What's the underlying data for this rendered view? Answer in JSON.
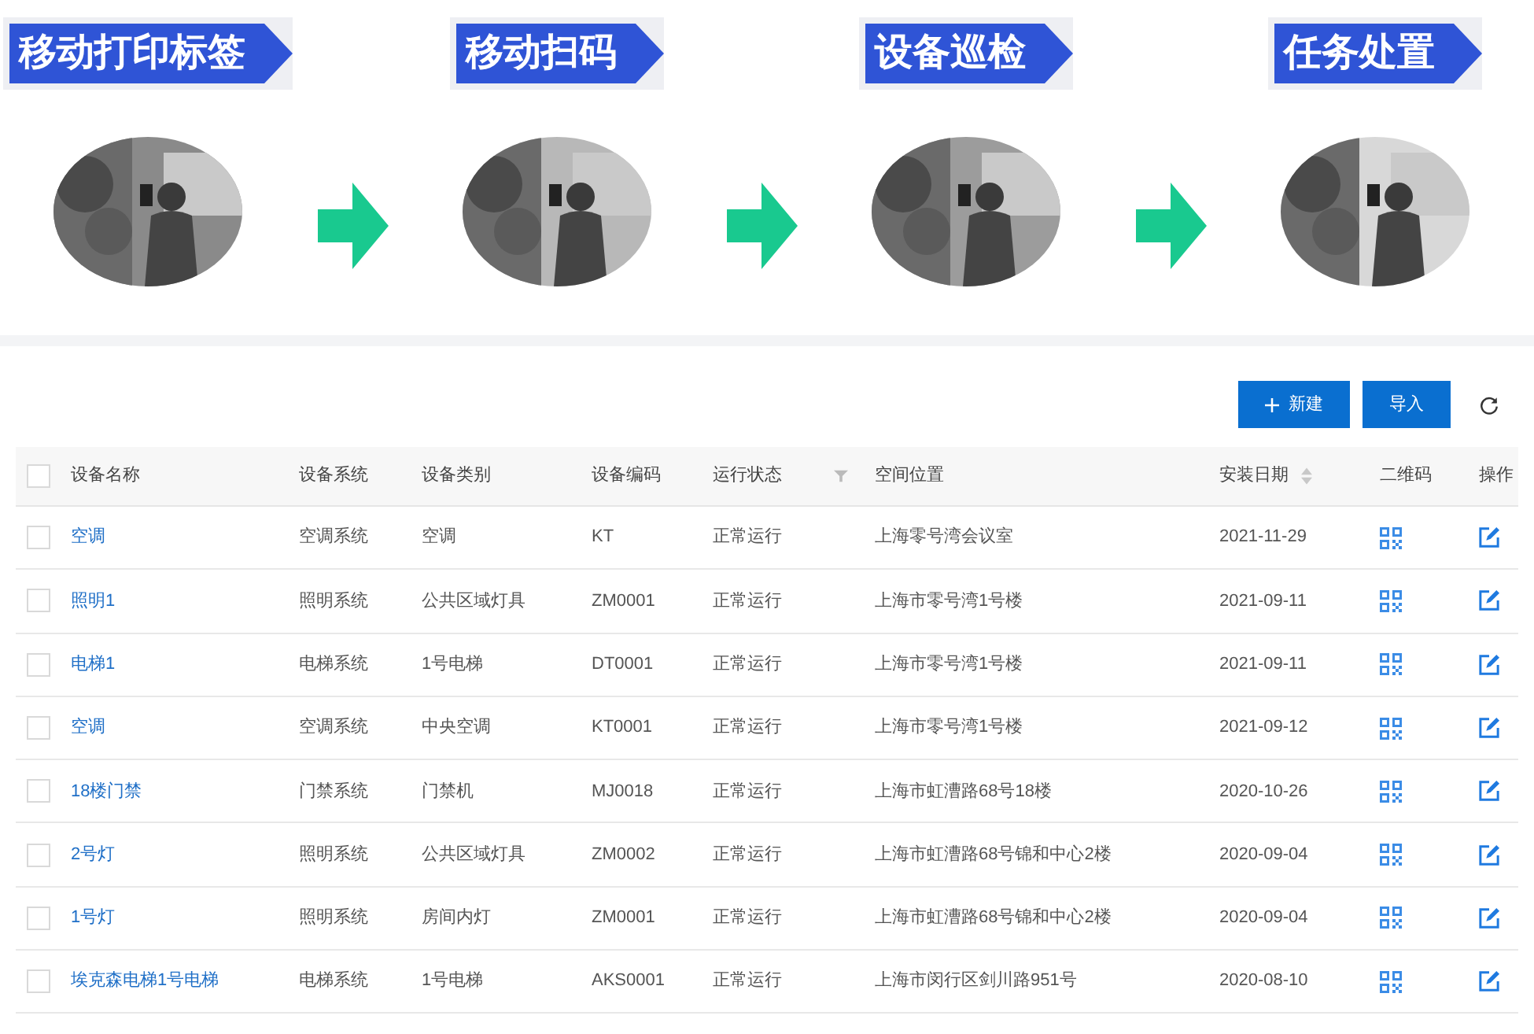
{
  "steps": [
    {
      "label": "移动打印标签",
      "kind": "picture"
    },
    {
      "label": "移动扫码",
      "kind": "picture"
    },
    {
      "label": "设备巡检",
      "kind": "picture"
    },
    {
      "label": "任务处置",
      "kind": "picture"
    }
  ],
  "toolbar": {
    "buttons": [
      {
        "label": "新建",
        "kind": "add"
      },
      {
        "label": "导入",
        "kind": "plain"
      }
    ]
  },
  "table": {
    "all_selected": false,
    "columns": [
      "设备名称",
      "设备系统",
      "设备类别",
      "设备编码",
      "运行状态",
      "空间位置",
      "安装日期",
      "二维码",
      "操作"
    ],
    "rows": [
      {
        "selected": false,
        "cells": [
          "空调",
          "空调系统",
          "空调",
          "KT",
          "正常运行",
          "上海零号湾会议室",
          "2021-11-29"
        ]
      },
      {
        "selected": false,
        "cells": [
          "照明1",
          "照明系统",
          "公共区域灯具",
          "ZM0001",
          "正常运行",
          "上海市零号湾1号楼",
          "2021-09-11"
        ]
      },
      {
        "selected": false,
        "cells": [
          "电梯1",
          "电梯系统",
          "1号电梯",
          "DT0001",
          "正常运行",
          "上海市零号湾1号楼",
          "2021-09-11"
        ]
      },
      {
        "selected": false,
        "cells": [
          "空调",
          "空调系统",
          "中央空调",
          "KT0001",
          "正常运行",
          "上海市零号湾1号楼",
          "2021-09-12"
        ]
      },
      {
        "selected": false,
        "cells": [
          "18楼门禁",
          "门禁系统",
          "门禁机",
          "MJ0018",
          "正常运行",
          "上海市虹漕路68号18楼",
          "2020-10-26"
        ]
      },
      {
        "selected": false,
        "cells": [
          "2号灯",
          "照明系统",
          "公共区域灯具",
          "ZM0002",
          "正常运行",
          "上海市虹漕路68号锦和中心2楼",
          "2020-09-04"
        ]
      },
      {
        "selected": false,
        "cells": [
          "1号灯",
          "照明系统",
          "房间内灯",
          "ZM0001",
          "正常运行",
          "上海市虹漕路68号锦和中心2楼",
          "2020-09-04"
        ]
      },
      {
        "selected": false,
        "cells": [
          "埃克森电梯1号电梯",
          "电梯系统",
          "1号电梯",
          "AKS0001",
          "正常运行",
          "上海市闵行区剑川路951号",
          "2020-08-10"
        ]
      }
    ]
  }
}
